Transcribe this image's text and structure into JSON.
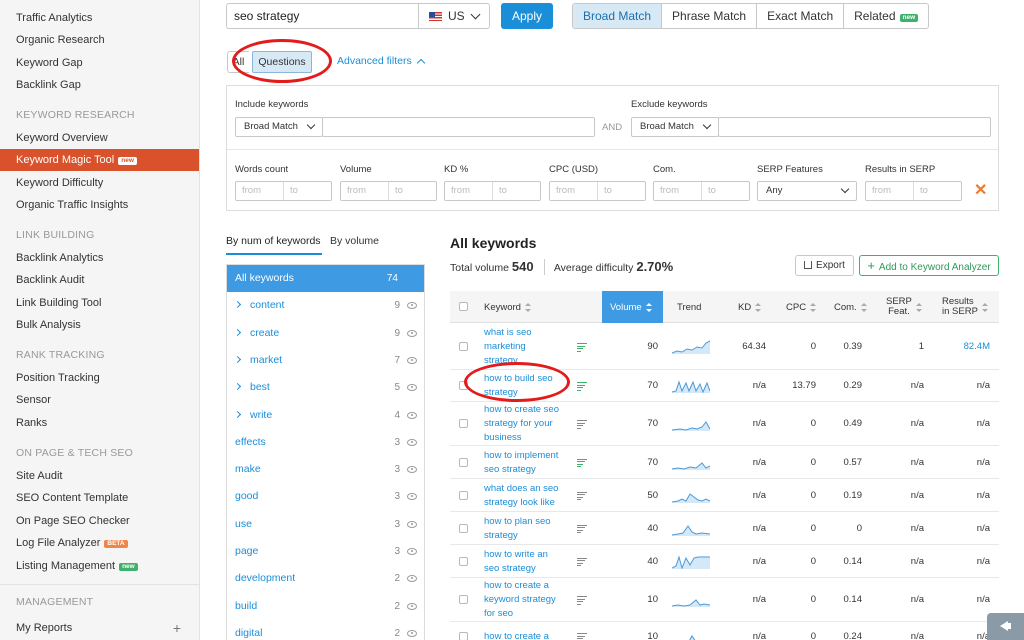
{
  "sidebar": {
    "items_top": [
      "Traffic Analytics",
      "Organic Research",
      "Keyword Gap",
      "Backlink Gap"
    ],
    "sections": [
      {
        "title": "KEYWORD RESEARCH",
        "items": [
          "Keyword Overview",
          "Keyword Magic Tool",
          "Keyword Difficulty",
          "Organic Traffic Insights"
        ]
      },
      {
        "title": "LINK BUILDING",
        "items": [
          "Backlink Analytics",
          "Backlink Audit",
          "Link Building Tool",
          "Bulk Analysis"
        ]
      },
      {
        "title": "RANK TRACKING",
        "items": [
          "Position Tracking",
          "Sensor",
          "Ranks"
        ]
      },
      {
        "title": "ON PAGE & TECH SEO",
        "items": [
          "Site Audit",
          "SEO Content Template",
          "On Page SEO Checker",
          "Log File Analyzer",
          "Listing Management"
        ]
      },
      {
        "title": "MANAGEMENT",
        "items": [
          "My Reports"
        ]
      }
    ],
    "active_item": "Keyword Magic Tool",
    "badges": {
      "new": "new",
      "beta": "BETA"
    },
    "plus_icon": "+"
  },
  "search": {
    "query": "seo strategy",
    "database": "US",
    "apply_label": "Apply"
  },
  "match_tabs": [
    {
      "label": "Broad Match",
      "active": true
    },
    {
      "label": "Phrase Match",
      "active": false
    },
    {
      "label": "Exact Match",
      "active": false
    },
    {
      "label": "Related",
      "active": false,
      "badge": "new"
    }
  ],
  "question_tabs": {
    "all": "All",
    "questions": "Questions"
  },
  "advanced_filters_label": "Advanced filters",
  "filters": {
    "include_label": "Include keywords",
    "include_match": "Broad Match",
    "and_label": "AND",
    "exclude_label": "Exclude keywords",
    "exclude_match": "Broad Match",
    "range_labels": [
      "Words count",
      "Volume",
      "KD %",
      "CPC (USD)",
      "Com."
    ],
    "from_placeholder": "from",
    "to_placeholder": "to",
    "serp_features_label": "SERP Features",
    "serp_features_value": "Any",
    "results_label": "Results in SERP",
    "clear_icon": "✕"
  },
  "group_tabs": [
    "By num of keywords",
    "By volume"
  ],
  "groups": [
    {
      "label": "All keywords",
      "count": "74",
      "active": true,
      "expandable": false
    },
    {
      "label": "content",
      "count": "9",
      "expandable": true
    },
    {
      "label": "create",
      "count": "9",
      "expandable": true
    },
    {
      "label": "market",
      "count": "7",
      "expandable": true
    },
    {
      "label": "best",
      "count": "5",
      "expandable": true
    },
    {
      "label": "write",
      "count": "4",
      "expandable": true
    },
    {
      "label": "effects",
      "count": "3",
      "expandable": false
    },
    {
      "label": "make",
      "count": "3",
      "expandable": false
    },
    {
      "label": "good",
      "count": "3",
      "expandable": false
    },
    {
      "label": "use",
      "count": "3",
      "expandable": false
    },
    {
      "label": "page",
      "count": "3",
      "expandable": false
    },
    {
      "label": "development",
      "count": "2",
      "expandable": false
    },
    {
      "label": "build",
      "count": "2",
      "expandable": false
    },
    {
      "label": "digital",
      "count": "2",
      "expandable": false
    }
  ],
  "results": {
    "title": "All keywords",
    "total_volume_label": "Total volume",
    "total_volume": "540",
    "avg_difficulty_label": "Average difficulty",
    "avg_difficulty": "2.70%",
    "export_label": "Export",
    "add_label": "Add to Keyword Analyzer",
    "add_icon": "+"
  },
  "table": {
    "headers": {
      "keyword": "Keyword",
      "volume": "Volume",
      "trend": "Trend",
      "kd": "KD",
      "cpc": "CPC",
      "com": "Com.",
      "serp": [
        "SERP",
        "Feat."
      ],
      "results": [
        "Results",
        "in SERP"
      ]
    },
    "rows": [
      {
        "keyword": [
          "what is seo",
          "marketing",
          "strategy"
        ],
        "volume": "90",
        "kd": "64.34",
        "cpc": "0",
        "com": "0.39",
        "serp": "1",
        "results": "82.4M",
        "serp_icon": "green"
      },
      {
        "keyword": [
          "how to build seo",
          "strategy"
        ],
        "volume": "70",
        "kd": "n/a",
        "cpc": "13.79",
        "com": "0.29",
        "serp": "n/a",
        "results": "n/a",
        "serp_icon": "green"
      },
      {
        "keyword": [
          "how to create seo",
          "strategy for your",
          "business"
        ],
        "volume": "70",
        "kd": "n/a",
        "cpc": "0",
        "com": "0.49",
        "serp": "n/a",
        "results": "n/a",
        "serp_icon": "gray"
      },
      {
        "keyword": [
          "how to implement",
          "seo strategy"
        ],
        "volume": "70",
        "kd": "n/a",
        "cpc": "0",
        "com": "0.57",
        "serp": "n/a",
        "results": "n/a",
        "serp_icon": "green"
      },
      {
        "keyword": [
          "what does an seo",
          "strategy look like"
        ],
        "volume": "50",
        "kd": "n/a",
        "cpc": "0",
        "com": "0.19",
        "serp": "n/a",
        "results": "n/a",
        "serp_icon": "gray"
      },
      {
        "keyword": [
          "how to plan seo",
          "strategy"
        ],
        "volume": "40",
        "kd": "n/a",
        "cpc": "0",
        "com": "0",
        "serp": "n/a",
        "results": "n/a",
        "serp_icon": "gray"
      },
      {
        "keyword": [
          "how to write an",
          "seo strategy"
        ],
        "volume": "40",
        "kd": "n/a",
        "cpc": "0",
        "com": "0.14",
        "serp": "n/a",
        "results": "n/a",
        "serp_icon": "gray"
      },
      {
        "keyword": [
          "how to create a",
          "keyword strategy",
          "for seo"
        ],
        "volume": "10",
        "kd": "n/a",
        "cpc": "0",
        "com": "0.14",
        "serp": "n/a",
        "results": "n/a",
        "serp_icon": "gray"
      },
      {
        "keyword": [
          "how to create a"
        ],
        "volume": "10",
        "kd": "n/a",
        "cpc": "0",
        "com": "0.24",
        "serp": "n/a",
        "results": "n/a",
        "serp_icon": "gray"
      }
    ]
  },
  "colors": {
    "accent": "#d9522b",
    "link": "#1b8ed8",
    "highlight": "#e31b1b",
    "green": "#3fb16d"
  }
}
